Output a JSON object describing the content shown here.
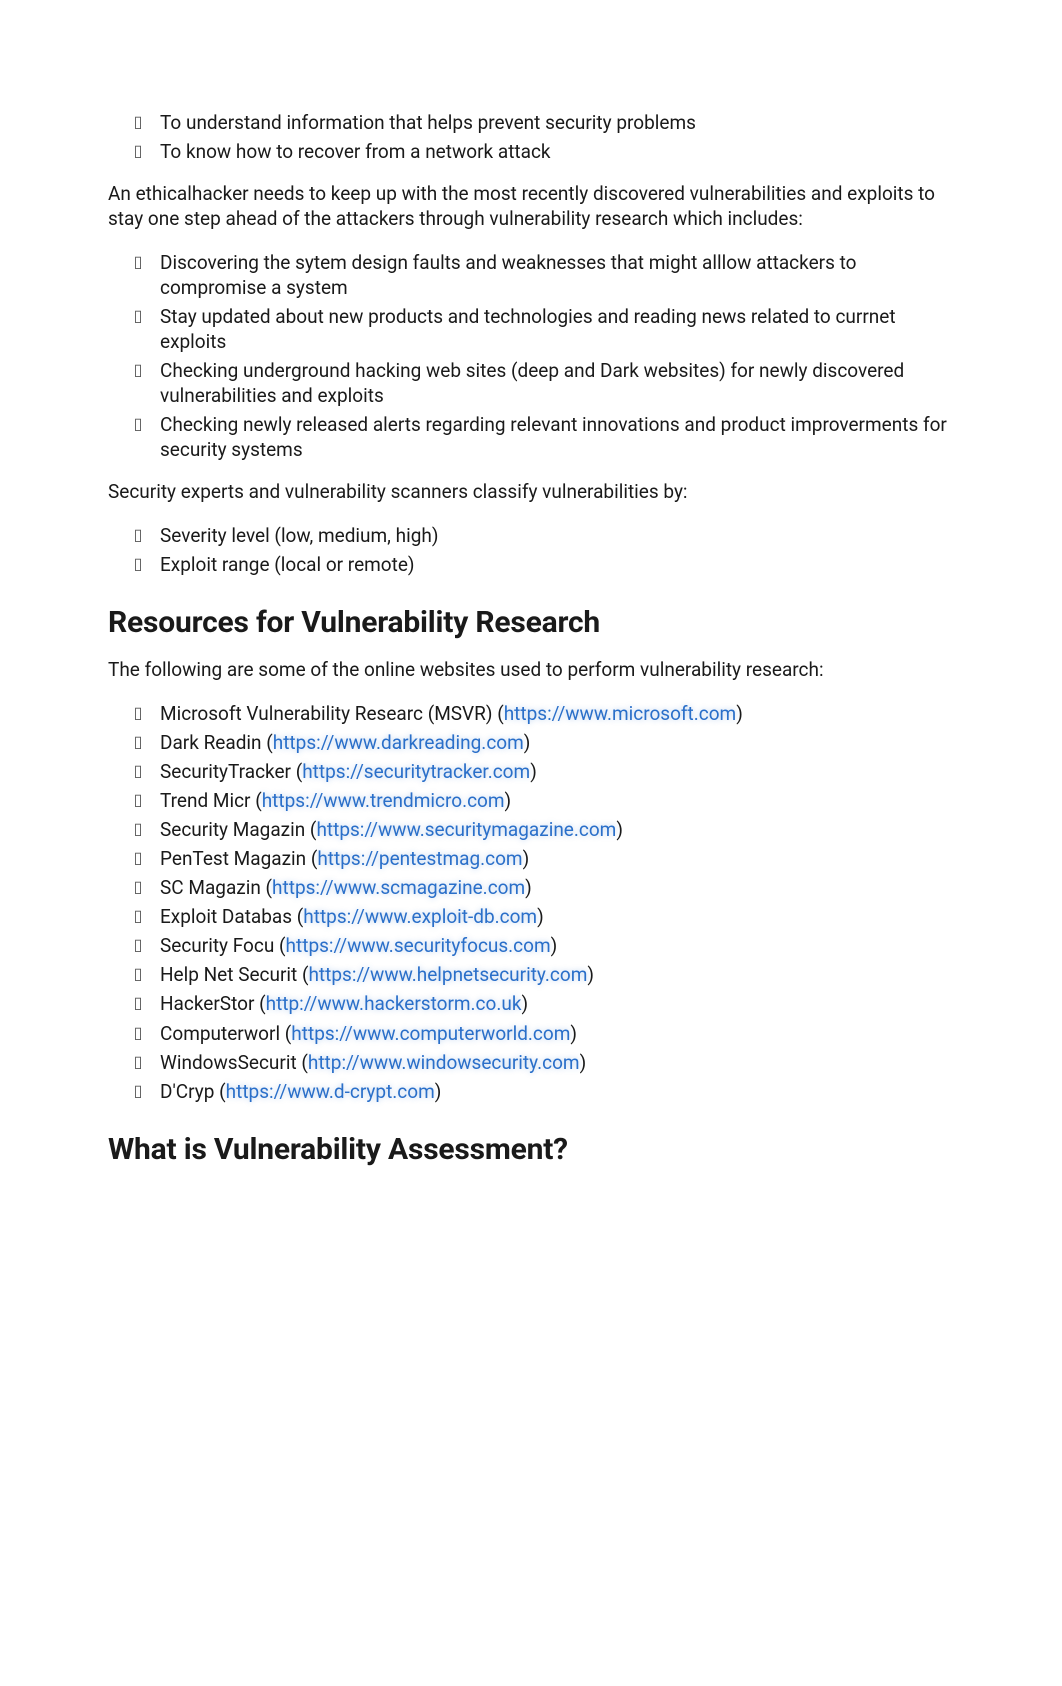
{
  "introPoints": [
    "To understand information that helps prevent security problems",
    "To know how to recover from a network attack"
  ],
  "para1": "An ethicalhacker needs to keep up with the most recently discovered vulnerabilities and exploits to stay one step ahead of the attackers through vulnerability research which includes:",
  "researchIncludes": [
    "Discovering the sytem design faults and weaknesses that might alllow attackers to compromise a system",
    "Stay updated about new products and technologies and reading news related to currnet exploits",
    "Checking underground hacking web sites (deep and Dark websites) for newly discovered vulnerabilities and exploits",
    "Checking newly released alerts regarding relevant innovations and product improverments for security systems"
  ],
  "para2": "Security experts and vulnerability scanners classify vulnerabilities by:",
  "classifyBy": [
    "Severity level (low, medium, high)",
    "Exploit range (local or remote)"
  ],
  "headings": {
    "resources": "Resources for Vulnerability Research",
    "assessment": "What is Vulnerability Assessment?"
  },
  "para3": "The following are some of the online websites used to perform vulnerability research:",
  "resources": [
    {
      "label": "Microsoft Vulnerability Researc (MSVR) (",
      "url": "https://www.microsoft.com",
      "tail": ")"
    },
    {
      "label": "Dark Readin (",
      "url": "https://www.darkreading.com",
      "tail": ")"
    },
    {
      "label": "SecurityTracker (",
      "url": "https://securitytracker.com",
      "tail": ")"
    },
    {
      "label": "Trend Micr (",
      "url": "https://www.trendmicro.com",
      "tail": ")"
    },
    {
      "label": "Security Magazin (",
      "url": "https://www.securitymagazine.com",
      "tail": ")"
    },
    {
      "label": "PenTest Magazin (",
      "url": "https://pentestmag.com",
      "tail": ")"
    },
    {
      "label": "SC Magazin (",
      "url": "https://www.scmagazine.com",
      "tail": ")"
    },
    {
      "label": "Exploit Databas (",
      "url": "https://www.exploit-db.com",
      "tail": ")"
    },
    {
      "label": "Security Focu (",
      "url": "https://www.securityfocus.com",
      "tail": ")"
    },
    {
      "label": "Help Net Securit (",
      "url": "https://www.helpnetsecurity.com",
      "tail": ")"
    },
    {
      "label": "HackerStor (",
      "url": "http://www.hackerstorm.co.uk",
      "tail": ")"
    },
    {
      "label": "Computerworl (",
      "url": "https://www.computerworld.com",
      "tail": ")"
    },
    {
      "label": "WindowsSecurit (",
      "url": "http://www.windowsecurity.com",
      "tail": ")"
    },
    {
      "label": "D'Cryp (",
      "url": "https://www.d-crypt.com",
      "tail": ")"
    }
  ]
}
